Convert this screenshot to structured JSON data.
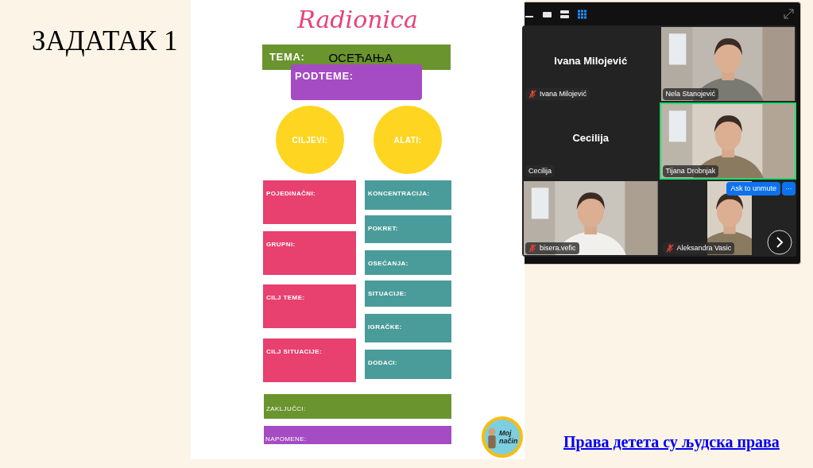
{
  "slide": {
    "title": "ЗАДАТАК 1",
    "link": "Права детета су људска права"
  },
  "worksheet": {
    "title": "Radionica",
    "topic": {
      "label": "TEMA:",
      "value": "ОСЕЋАЊА"
    },
    "subtopics": {
      "label": "PODTEME:"
    },
    "circles": [
      "CILJEVI:",
      "ALATI:"
    ],
    "goals": [
      "POJEDINAČNI:",
      "GRUPNI:",
      "CILJ TEME:",
      "CILJ SITUACIJE:"
    ],
    "tools": [
      "KONCENTRACIJA:",
      "POKRET:",
      "OSEĆANJA:",
      "SITUACIJE:",
      "IGRAČKE:",
      "DODACI:"
    ],
    "conclusions": "ZAKLJUČCI:",
    "notes": "NAPOMENE:",
    "logo": "Moj način"
  },
  "meeting": {
    "views": [
      {
        "kind": "minimize",
        "selected": false
      },
      {
        "kind": "speaker",
        "selected": false
      },
      {
        "kind": "strip",
        "selected": false
      },
      {
        "kind": "gallery",
        "selected": true
      }
    ],
    "tiles": [
      {
        "kind": "name",
        "display_name": "Ivana Milojević",
        "label": "Ivana Milojević",
        "muted": true,
        "active": false
      },
      {
        "kind": "video",
        "label": "Nela Stanojević",
        "muted": false,
        "active": false
      },
      {
        "kind": "name",
        "display_name": "Cecilija",
        "label": "Cecilija",
        "muted": false,
        "active": false
      },
      {
        "kind": "video",
        "label": "Tijana Drobnjak",
        "muted": false,
        "active": true
      },
      {
        "kind": "video",
        "label": "bisera.vefic",
        "muted": true,
        "active": false
      },
      {
        "kind": "strip",
        "label": "Aleksandra Vasic",
        "muted": true,
        "active": false
      }
    ],
    "ask_button": "Ask to unmute",
    "more_button": "···"
  }
}
